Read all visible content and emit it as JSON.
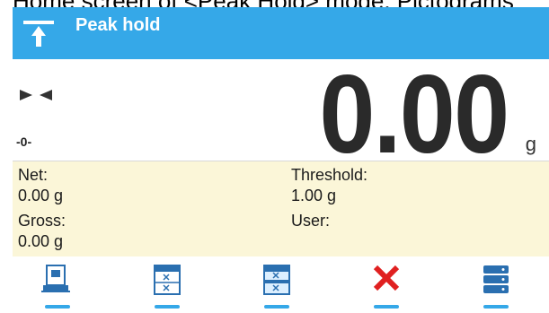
{
  "caption": "Home screen of <Peak Hold> mode. Pictograms",
  "titlebar": {
    "title": "Peak hold",
    "mode_icon": "peak-hold-icon",
    "color": "#35a8e8"
  },
  "display": {
    "stable_icon": "stable-indicator-icon",
    "zero_indicator": "-0-",
    "reading": "0.00",
    "unit": "g"
  },
  "info": {
    "background": "#fbf6d8",
    "net_label": "Net:",
    "net_value": "0.00 g",
    "gross_label": "Gross:",
    "gross_value": "0.00 g",
    "threshold_label": "Threshold:",
    "threshold_value": "1.00 g",
    "user_label": "User:",
    "user_value": ""
  },
  "softkeys": [
    {
      "icon": "weighing-device-icon"
    },
    {
      "icon": "table-x-icon"
    },
    {
      "icon": "table-x-highlight-icon"
    },
    {
      "icon": "close-x-icon"
    },
    {
      "icon": "database-icon"
    }
  ]
}
